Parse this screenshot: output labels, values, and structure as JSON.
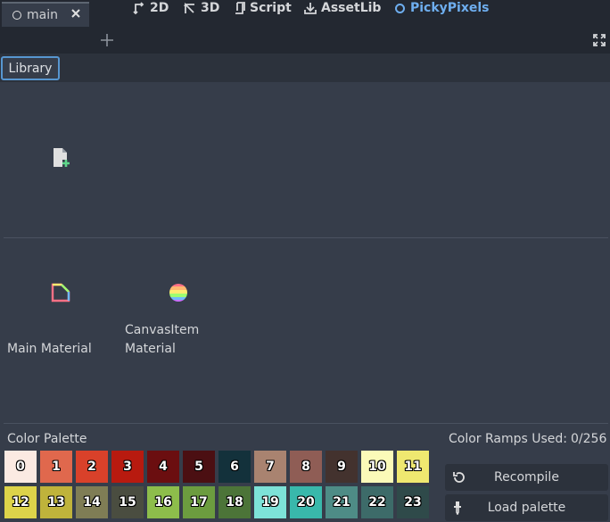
{
  "workspaces": [
    {
      "label": "2D",
      "active": false
    },
    {
      "label": "3D",
      "active": false
    },
    {
      "label": "Script",
      "active": false
    },
    {
      "label": "AssetLib",
      "active": false
    },
    {
      "label": "PickyPixels",
      "active": true
    }
  ],
  "scene_tab": {
    "label": "main"
  },
  "editor": {
    "library_button": "Library",
    "materials": [
      {
        "label_line1": "Main Material",
        "label_line2": "",
        "icon": "material-icon"
      },
      {
        "label_line1": "CanvasItem",
        "label_line2": "Material",
        "icon": "rainbow-sphere-icon"
      }
    ]
  },
  "palette": {
    "label": "Color Palette",
    "ramps_label": "Color Ramps Used:",
    "ramps_count": "0/256",
    "swatches": [
      {
        "num": "0",
        "color": "#fbeae2"
      },
      {
        "num": "1",
        "color": "#e0684d"
      },
      {
        "num": "2",
        "color": "#d9412a"
      },
      {
        "num": "3",
        "color": "#b81a0f"
      },
      {
        "num": "4",
        "color": "#6b0e10"
      },
      {
        "num": "5",
        "color": "#4b0f12"
      },
      {
        "num": "6",
        "color": "#13313b"
      },
      {
        "num": "7",
        "color": "#a98370"
      },
      {
        "num": "8",
        "color": "#8f5d55"
      },
      {
        "num": "9",
        "color": "#43322e"
      },
      {
        "num": "10",
        "color": "#fbfab8"
      },
      {
        "num": "11",
        "color": "#efe870"
      },
      {
        "num": "12",
        "color": "#ddd34a"
      },
      {
        "num": "13",
        "color": "#bfb33b"
      },
      {
        "num": "14",
        "color": "#7f7d55"
      },
      {
        "num": "15",
        "color": "#4a4d40"
      },
      {
        "num": "16",
        "color": "#8dbd4b"
      },
      {
        "num": "17",
        "color": "#6c9c3f"
      },
      {
        "num": "18",
        "color": "#4c7438"
      },
      {
        "num": "19",
        "color": "#7de2d8"
      },
      {
        "num": "20",
        "color": "#39b8ab"
      },
      {
        "num": "21",
        "color": "#4e8c86"
      },
      {
        "num": "22",
        "color": "#3d6b69"
      },
      {
        "num": "23",
        "color": "#2f4a4a"
      }
    ],
    "recompile_label": "Recompile",
    "load_palette_label": "Load palette"
  },
  "icons": {
    "recompile": "reload-icon",
    "load_palette": "eyedropper-icon",
    "new_material": "new-file-icon"
  }
}
